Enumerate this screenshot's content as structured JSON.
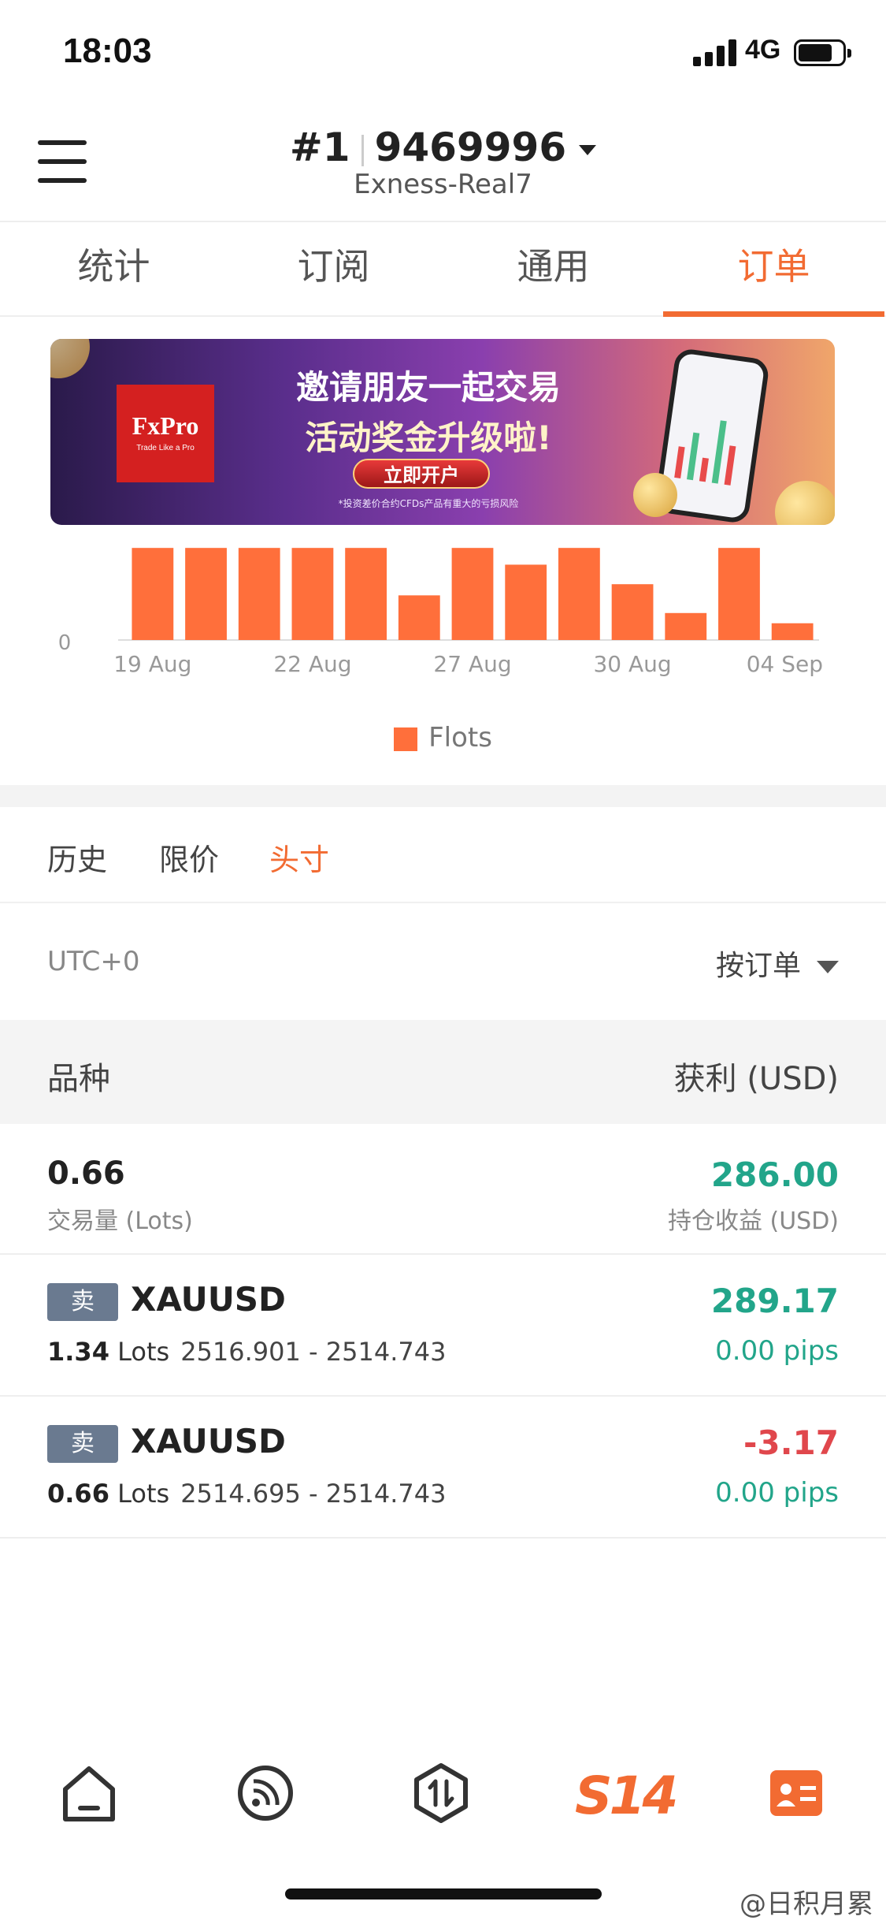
{
  "status_bar": {
    "time": "18:03",
    "network": "4G"
  },
  "header": {
    "account_prefix": "#1",
    "account_number": "9469996",
    "server": "Exness-Real7"
  },
  "tabs": [
    {
      "label": "统计"
    },
    {
      "label": "订阅"
    },
    {
      "label": "通用"
    },
    {
      "label": "订单",
      "active": true
    }
  ],
  "banner": {
    "brand": "FxPro",
    "slogan": "Trade Like a Pro",
    "title1": "邀请朋友一起交易",
    "title2": "活动奖金升级啦!",
    "cta": "立即开户",
    "disclaimer": "*投资差价合约CFDs产品有重大的亏损风险"
  },
  "chart_data": {
    "type": "bar",
    "series": [
      {
        "name": "Flots",
        "color": "#ff6f3b",
        "values": [
          0.99,
          0.99,
          0.99,
          0.99,
          0.99,
          0.48,
          0.99,
          0.81,
          0.99,
          0.6,
          0.29,
          0.99,
          0.18
        ]
      }
    ],
    "x_tick_labels": [
      "19 Aug",
      "22 Aug",
      "27 Aug",
      "30 Aug",
      "04 Sep"
    ],
    "y_tick_labels": [
      "0"
    ],
    "ylim": [
      0,
      1.0
    ],
    "legend": "bottom"
  },
  "subtabs": [
    {
      "label": "历史"
    },
    {
      "label": "限价"
    },
    {
      "label": "头寸",
      "active": true
    }
  ],
  "filter": {
    "timezone": "UTC+0",
    "sort_label": "按订单"
  },
  "columns": {
    "left": "品种",
    "right": "获利 (USD)"
  },
  "summary": {
    "volume": "0.66",
    "volume_label": "交易量 (Lots)",
    "profit": "286.00",
    "profit_label": "持仓收益 (USD)"
  },
  "positions": [
    {
      "side": "卖",
      "symbol": "XAUUSD",
      "lots": "1.34",
      "lots_unit": "Lots",
      "prices": "2516.901 - 2514.743",
      "profit": "289.17",
      "pips": "0.00 pips"
    },
    {
      "side": "卖",
      "symbol": "XAUUSD",
      "lots": "0.66",
      "lots_unit": "Lots",
      "prices": "2514.695 - 2514.743",
      "profit": "-3.17",
      "pips": "0.00 pips"
    }
  ],
  "bottom_nav": {
    "s14_label": "S14"
  },
  "watermark": "@日积月累"
}
